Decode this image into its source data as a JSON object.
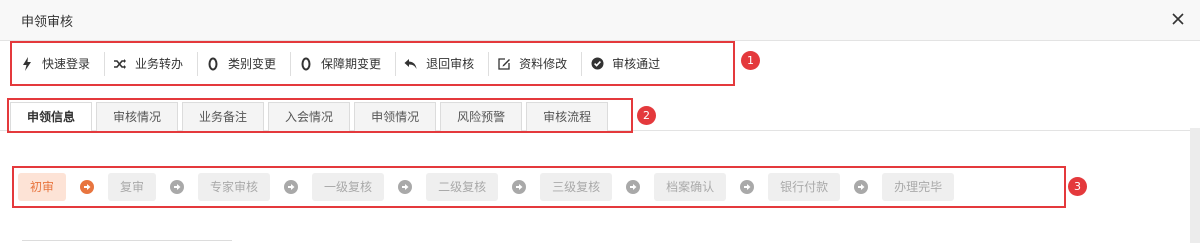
{
  "window": {
    "title": "申领审核",
    "close_icon": "close-icon"
  },
  "toolbar": {
    "items": [
      {
        "label": "快速登录",
        "icon": "lightning-icon"
      },
      {
        "label": "业务转办",
        "icon": "shuffle-icon"
      },
      {
        "label": "类别变更",
        "icon": "zero-icon"
      },
      {
        "label": "保障期变更",
        "icon": "zero-icon"
      },
      {
        "label": "退回审核",
        "icon": "reply-icon"
      },
      {
        "label": "资料修改",
        "icon": "edit-icon"
      },
      {
        "label": "审核通过",
        "icon": "check-circle-icon"
      }
    ]
  },
  "tabs": {
    "items": [
      "申领信息",
      "审核情况",
      "业务备注",
      "入会情况",
      "申领情况",
      "风险预警",
      "审核流程"
    ],
    "active": "申领信息"
  },
  "steps": {
    "items": [
      "初审",
      "复审",
      "专家审核",
      "一级复核",
      "二级复核",
      "三级复核",
      "档案确认",
      "银行付款",
      "办理完毕"
    ],
    "current": "初审"
  },
  "badges": [
    "1",
    "2",
    "3"
  ],
  "colors": {
    "highlight": "#e4393c",
    "step_active_bg": "#fde3d6",
    "step_active_text": "#e8753f",
    "arrow_inactive": "#a9a9a9"
  }
}
